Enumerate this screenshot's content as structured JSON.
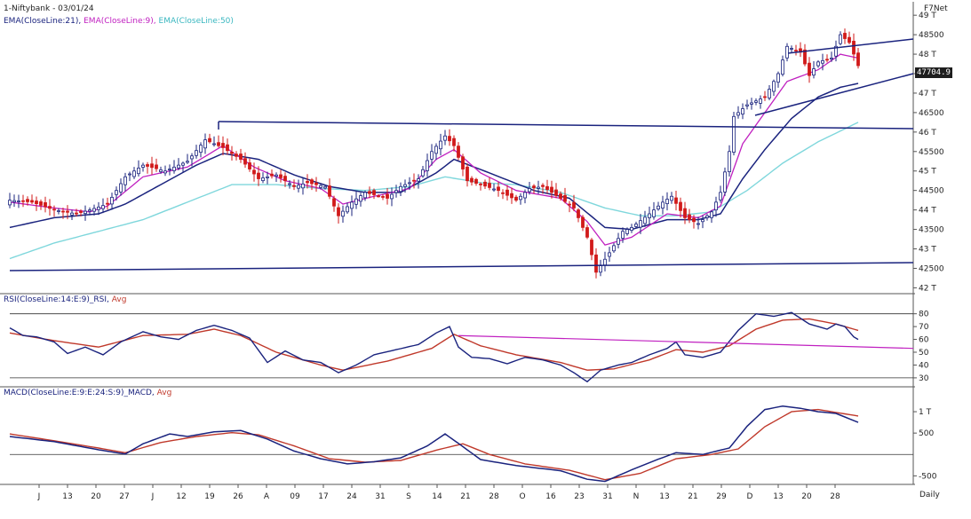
{
  "header": {
    "title": "1-Niftybank - 03/01/24",
    "brand": "F7Net",
    "frequency": "Daily",
    "last_price": "47704.9"
  },
  "colors": {
    "ema21": "#1a237e",
    "ema9": "#c020c0",
    "ema50": "#7fd7dc",
    "up_candle": "#1a237e",
    "down_candle": "#d11a1a",
    "rsi_line": "#1a237e",
    "rsi_avg": "#c0392b",
    "macd_line": "#1a237e",
    "macd_avg": "#c0392b",
    "trendline": "#1a237e",
    "rsi_trendline": "#c020c0"
  },
  "legends": {
    "ema": [
      {
        "text": "EMA(CloseLine:21)",
        "color": "#1a237e"
      },
      {
        "text": "EMA(CloseLine:9)",
        "color": "#c020c0"
      },
      {
        "text": "EMA(CloseLine:50)",
        "color": "#3ab7c0"
      }
    ],
    "rsi": [
      {
        "text": "RSI(CloseLine:14:E:9)_RSI",
        "color": "#1a237e"
      },
      {
        "text": "Avg",
        "color": "#c0392b"
      }
    ],
    "macd": [
      {
        "text": "MACD(CloseLine:E:9:E:24:S:9)_MACD",
        "color": "#1a237e"
      },
      {
        "text": "Avg",
        "color": "#c0392b"
      }
    ]
  },
  "chart_data": [
    {
      "type": "candlestick",
      "panel": "price",
      "title": "1-Niftybank - 03/01/24",
      "y_ticks": [
        "49 T",
        "48500",
        "48 T",
        "47500",
        "47 T",
        "46500",
        "46 T",
        "45500",
        "45 T",
        "44500",
        "44 T",
        "43500",
        "43 T",
        "42500",
        "42 T"
      ],
      "y_tick_values": [
        49000,
        48500,
        48000,
        47500,
        47000,
        46500,
        46000,
        45500,
        45000,
        44500,
        44000,
        43500,
        43000,
        42500,
        42000
      ],
      "ylim": [
        41850,
        49300
      ],
      "x_labels": [
        "J",
        "13",
        "20",
        "27",
        "J",
        "12",
        "19",
        "26",
        "A",
        "09",
        "17",
        "24",
        "31",
        "S",
        "14",
        "21",
        "28",
        "O",
        "16",
        "23",
        "31",
        "N",
        "13",
        "21",
        "29",
        "D",
        "13",
        "20",
        "28"
      ],
      "last_value": 47704.9,
      "close_anchors": [
        [
          0,
          44250
        ],
        [
          5,
          44200
        ],
        [
          10,
          44000
        ],
        [
          15,
          43900
        ],
        [
          18,
          44000
        ],
        [
          22,
          44150
        ],
        [
          26,
          44850
        ],
        [
          30,
          45150
        ],
        [
          35,
          45000
        ],
        [
          40,
          45250
        ],
        [
          44,
          45800
        ],
        [
          48,
          45600
        ],
        [
          52,
          45300
        ],
        [
          56,
          44800
        ],
        [
          60,
          44900
        ],
        [
          64,
          44600
        ],
        [
          67,
          44700
        ],
        [
          71,
          44600
        ],
        [
          74,
          43850
        ],
        [
          77,
          44200
        ],
        [
          80,
          44450
        ],
        [
          85,
          44300
        ],
        [
          88,
          44600
        ],
        [
          92,
          44800
        ],
        [
          95,
          45500
        ],
        [
          98,
          45900
        ],
        [
          100,
          45650
        ],
        [
          103,
          44750
        ],
        [
          106,
          44650
        ],
        [
          110,
          44500
        ],
        [
          114,
          44250
        ],
        [
          117,
          44550
        ],
        [
          120,
          44600
        ],
        [
          124,
          44300
        ],
        [
          127,
          44050
        ],
        [
          130,
          43300
        ],
        [
          132,
          42400
        ],
        [
          135,
          42900
        ],
        [
          138,
          43450
        ],
        [
          140,
          43550
        ],
        [
          144,
          43900
        ],
        [
          147,
          44200
        ],
        [
          149,
          44350
        ],
        [
          152,
          43800
        ],
        [
          155,
          43650
        ],
        [
          158,
          43950
        ],
        [
          160,
          44450
        ],
        [
          162,
          45500
        ],
        [
          163,
          46400
        ],
        [
          166,
          46700
        ],
        [
          170,
          46900
        ],
        [
          173,
          47500
        ],
        [
          175,
          48200
        ],
        [
          178,
          48050
        ],
        [
          180,
          47450
        ],
        [
          182,
          47800
        ],
        [
          185,
          47900
        ],
        [
          187,
          48500
        ],
        [
          189,
          48300
        ],
        [
          191,
          47704.9
        ]
      ],
      "ema9_anchors": [
        [
          0,
          44200
        ],
        [
          10,
          44050
        ],
        [
          18,
          43950
        ],
        [
          22,
          44100
        ],
        [
          30,
          44850
        ],
        [
          40,
          45100
        ],
        [
          48,
          45650
        ],
        [
          55,
          45100
        ],
        [
          62,
          44750
        ],
        [
          70,
          44550
        ],
        [
          75,
          44150
        ],
        [
          82,
          44350
        ],
        [
          90,
          44550
        ],
        [
          96,
          45300
        ],
        [
          100,
          45550
        ],
        [
          106,
          44950
        ],
        [
          114,
          44500
        ],
        [
          124,
          44300
        ],
        [
          130,
          43700
        ],
        [
          134,
          43100
        ],
        [
          140,
          43300
        ],
        [
          148,
          43900
        ],
        [
          155,
          43800
        ],
        [
          160,
          44100
        ],
        [
          165,
          45700
        ],
        [
          170,
          46500
        ],
        [
          175,
          47300
        ],
        [
          182,
          47600
        ],
        [
          187,
          48000
        ],
        [
          191,
          47900
        ]
      ],
      "ema21_anchors": [
        [
          0,
          43550
        ],
        [
          10,
          43800
        ],
        [
          20,
          43900
        ],
        [
          26,
          44150
        ],
        [
          34,
          44650
        ],
        [
          42,
          45150
        ],
        [
          48,
          45450
        ],
        [
          56,
          45300
        ],
        [
          64,
          44900
        ],
        [
          72,
          44600
        ],
        [
          80,
          44450
        ],
        [
          88,
          44450
        ],
        [
          96,
          44950
        ],
        [
          100,
          45300
        ],
        [
          108,
          44950
        ],
        [
          118,
          44500
        ],
        [
          126,
          44300
        ],
        [
          134,
          43550
        ],
        [
          140,
          43500
        ],
        [
          148,
          43750
        ],
        [
          155,
          43750
        ],
        [
          160,
          43900
        ],
        [
          165,
          44800
        ],
        [
          170,
          45550
        ],
        [
          176,
          46350
        ],
        [
          182,
          46900
        ],
        [
          187,
          47150
        ],
        [
          191,
          47250
        ]
      ],
      "ema50_anchors": [
        [
          0,
          42750
        ],
        [
          10,
          43150
        ],
        [
          20,
          43450
        ],
        [
          30,
          43750
        ],
        [
          40,
          44200
        ],
        [
          50,
          44650
        ],
        [
          60,
          44650
        ],
        [
          70,
          44550
        ],
        [
          80,
          44500
        ],
        [
          90,
          44600
        ],
        [
          98,
          44850
        ],
        [
          106,
          44700
        ],
        [
          114,
          44650
        ],
        [
          124,
          44450
        ],
        [
          134,
          44050
        ],
        [
          142,
          43850
        ],
        [
          150,
          43850
        ],
        [
          158,
          43950
        ],
        [
          166,
          44500
        ],
        [
          174,
          45200
        ],
        [
          182,
          45750
        ],
        [
          191,
          46250
        ]
      ]
    },
    {
      "type": "line",
      "panel": "rsi",
      "title": "RSI(CloseLine:14:E:9)_RSI",
      "series": [
        {
          "name": "RSI"
        },
        {
          "name": "Avg"
        }
      ],
      "y_ticks": [
        "80",
        "70",
        "60",
        "50",
        "40",
        "30"
      ],
      "y_tick_values": [
        80,
        70,
        60,
        50,
        40,
        30
      ],
      "ylim": [
        23,
        86
      ],
      "rsi_anchors": [
        [
          0,
          69
        ],
        [
          3,
          63
        ],
        [
          6,
          62
        ],
        [
          10,
          58
        ],
        [
          13,
          49
        ],
        [
          17,
          54
        ],
        [
          21,
          48
        ],
        [
          25,
          58
        ],
        [
          30,
          66
        ],
        [
          34,
          62
        ],
        [
          38,
          60
        ],
        [
          42,
          67
        ],
        [
          46,
          71
        ],
        [
          50,
          67
        ],
        [
          54,
          61
        ],
        [
          58,
          42
        ],
        [
          62,
          51
        ],
        [
          66,
          44
        ],
        [
          70,
          42
        ],
        [
          74,
          34
        ],
        [
          78,
          40
        ],
        [
          82,
          48
        ],
        [
          87,
          52
        ],
        [
          92,
          56
        ],
        [
          96,
          65
        ],
        [
          99,
          70
        ],
        [
          101,
          54
        ],
        [
          104,
          46
        ],
        [
          108,
          45
        ],
        [
          112,
          41
        ],
        [
          116,
          46
        ],
        [
          120,
          44
        ],
        [
          124,
          40
        ],
        [
          127,
          34
        ],
        [
          130,
          27
        ],
        [
          133,
          36
        ],
        [
          137,
          40
        ],
        [
          140,
          42
        ],
        [
          144,
          48
        ],
        [
          148,
          53
        ],
        [
          150,
          58
        ],
        [
          152,
          48
        ],
        [
          156,
          46
        ],
        [
          160,
          50
        ],
        [
          164,
          67
        ],
        [
          168,
          80
        ],
        [
          172,
          78
        ],
        [
          176,
          81
        ],
        [
          180,
          72
        ],
        [
          184,
          68
        ],
        [
          186,
          72
        ],
        [
          188,
          70
        ],
        [
          190,
          62
        ],
        [
          191,
          60
        ]
      ],
      "avg_anchors": [
        [
          0,
          65
        ],
        [
          10,
          59
        ],
        [
          20,
          54
        ],
        [
          30,
          63
        ],
        [
          40,
          64
        ],
        [
          46,
          68
        ],
        [
          52,
          63
        ],
        [
          60,
          50
        ],
        [
          70,
          40
        ],
        [
          75,
          36
        ],
        [
          85,
          43
        ],
        [
          95,
          53
        ],
        [
          100,
          64
        ],
        [
          106,
          55
        ],
        [
          114,
          48
        ],
        [
          124,
          42
        ],
        [
          130,
          36
        ],
        [
          136,
          37
        ],
        [
          144,
          44
        ],
        [
          150,
          52
        ],
        [
          156,
          50
        ],
        [
          162,
          55
        ],
        [
          168,
          68
        ],
        [
          174,
          75
        ],
        [
          180,
          76
        ],
        [
          186,
          72
        ],
        [
          191,
          67
        ]
      ],
      "trendline_from": [
        101,
        63
      ],
      "trendline_to": [
        205,
        53
      ]
    },
    {
      "type": "line",
      "panel": "macd",
      "title": "MACD(CloseLine:E:9:E:24:S:9)_MACD",
      "series": [
        {
          "name": "MACD"
        },
        {
          "name": "Avg"
        }
      ],
      "y_ticks": [
        "1 T",
        "500",
        "-500"
      ],
      "y_tick_values": [
        1000,
        500,
        -500
      ],
      "ylim": [
        -700,
        1250
      ],
      "macd_anchors": [
        [
          0,
          420
        ],
        [
          10,
          300
        ],
        [
          20,
          110
        ],
        [
          26,
          10
        ],
        [
          30,
          250
        ],
        [
          36,
          480
        ],
        [
          40,
          420
        ],
        [
          46,
          530
        ],
        [
          52,
          560
        ],
        [
          58,
          360
        ],
        [
          64,
          80
        ],
        [
          70,
          -100
        ],
        [
          76,
          -220
        ],
        [
          82,
          -170
        ],
        [
          88,
          -80
        ],
        [
          94,
          200
        ],
        [
          98,
          480
        ],
        [
          101,
          260
        ],
        [
          106,
          -120
        ],
        [
          114,
          -260
        ],
        [
          124,
          -380
        ],
        [
          130,
          -580
        ],
        [
          134,
          -630
        ],
        [
          140,
          -360
        ],
        [
          146,
          -110
        ],
        [
          150,
          40
        ],
        [
          156,
          0
        ],
        [
          162,
          150
        ],
        [
          166,
          660
        ],
        [
          170,
          1050
        ],
        [
          174,
          1130
        ],
        [
          178,
          1080
        ],
        [
          182,
          1000
        ],
        [
          186,
          960
        ],
        [
          191,
          750
        ]
      ],
      "avg_anchors": [
        [
          0,
          480
        ],
        [
          10,
          320
        ],
        [
          20,
          150
        ],
        [
          26,
          40
        ],
        [
          34,
          280
        ],
        [
          42,
          420
        ],
        [
          50,
          510
        ],
        [
          56,
          460
        ],
        [
          64,
          200
        ],
        [
          72,
          -100
        ],
        [
          80,
          -180
        ],
        [
          88,
          -140
        ],
        [
          96,
          100
        ],
        [
          102,
          250
        ],
        [
          108,
          0
        ],
        [
          116,
          -220
        ],
        [
          126,
          -370
        ],
        [
          134,
          -590
        ],
        [
          142,
          -440
        ],
        [
          150,
          -100
        ],
        [
          158,
          0
        ],
        [
          164,
          130
        ],
        [
          170,
          650
        ],
        [
          176,
          1000
        ],
        [
          182,
          1050
        ],
        [
          188,
          950
        ],
        [
          191,
          900
        ]
      ]
    }
  ]
}
